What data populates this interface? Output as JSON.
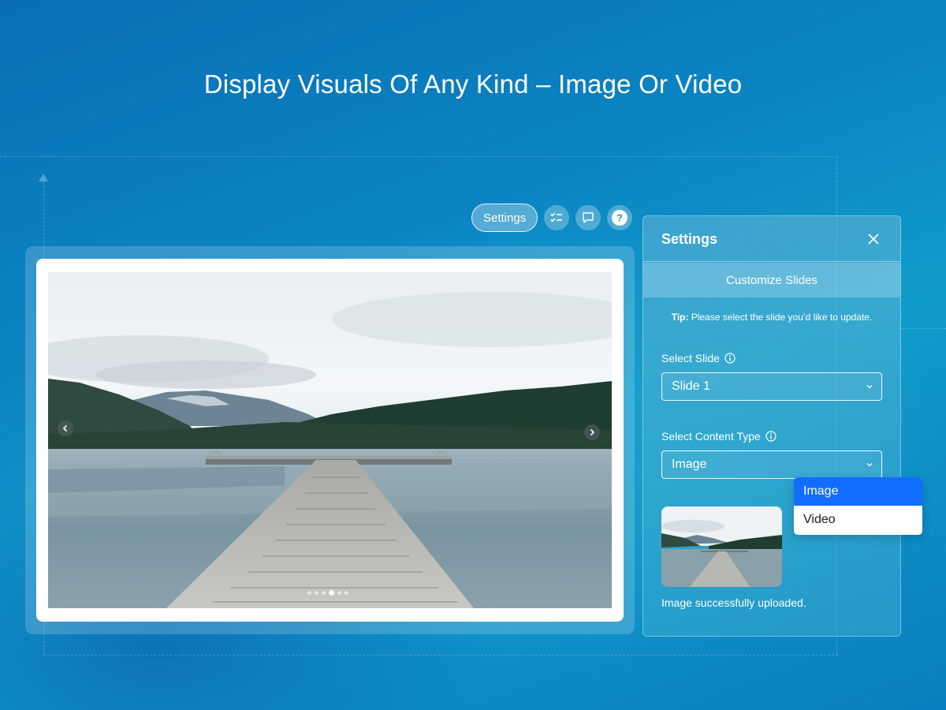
{
  "hero": {
    "title": "Display Visuals Of Any Kind – Image Or Video"
  },
  "toolbar": {
    "settings_label": "Settings",
    "icons": [
      "checklist-icon",
      "comment-icon",
      "help-icon"
    ]
  },
  "slideshow": {
    "dot_count": 6,
    "active_dot": 3,
    "prev_icon": "chevron-left-icon",
    "next_icon": "chevron-right-icon"
  },
  "panel": {
    "title": "Settings",
    "tab_label": "Customize Slides",
    "tip_bold": "Tip:",
    "tip_text": " Please select the slide you’d like to update.",
    "select_slide_label": "Select Slide",
    "select_slide_value": "Slide 1",
    "content_type_label": "Select Content Type",
    "content_type_value": "Image",
    "upload_message": "Image successfully uploaded."
  },
  "dropdown": {
    "options": [
      "Image",
      "Video"
    ],
    "selected": "Image"
  },
  "colors": {
    "accent": "#116dff",
    "background": "#0b84c2"
  }
}
